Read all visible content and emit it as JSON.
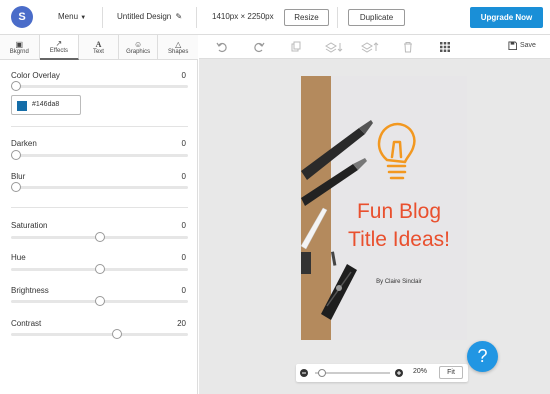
{
  "header": {
    "logo_letter": "S",
    "menu_label": "Menu",
    "design_name": "Untitled Design",
    "dimensions": "1410px × 2250px",
    "resize_label": "Resize",
    "duplicate_label": "Duplicate",
    "upgrade_label": "Upgrade Now"
  },
  "tabs": [
    {
      "label": "Bkgrnd",
      "icon": "image-icon",
      "active": false
    },
    {
      "label": "Effects",
      "icon": "wand-icon",
      "active": true
    },
    {
      "label": "Text",
      "icon": "text-icon",
      "active": false
    },
    {
      "label": "Graphics",
      "icon": "graphics-icon",
      "active": false
    },
    {
      "label": "Shapes",
      "icon": "shapes-icon",
      "active": false
    }
  ],
  "effects": {
    "color_overlay": {
      "label": "Color Overlay",
      "value": "0",
      "level": 0,
      "hex": "#146da8"
    },
    "darken": {
      "label": "Darken",
      "value": "0",
      "level": 0
    },
    "blur": {
      "label": "Blur",
      "value": "0",
      "level": 0
    },
    "saturation": {
      "label": "Saturation",
      "value": "0",
      "level": 0.5
    },
    "hue": {
      "label": "Hue",
      "value": "0",
      "level": 0.5
    },
    "brightness": {
      "label": "Brightness",
      "value": "0",
      "level": 0.5
    },
    "contrast": {
      "label": "Contrast",
      "value": "20",
      "level": 0.6
    }
  },
  "toolbar": {
    "save_label": "Save"
  },
  "design": {
    "title_line1": "Fun Blog",
    "title_line2": "Title Ideas!",
    "author": "By Claire Sinclair",
    "title_color": "#e9502e"
  },
  "zoom": {
    "percent": "20%",
    "fit_label": "Fit"
  },
  "help": {
    "label": "?"
  },
  "colors": {
    "accent": "#1a8fd7",
    "help": "#2196e3"
  }
}
